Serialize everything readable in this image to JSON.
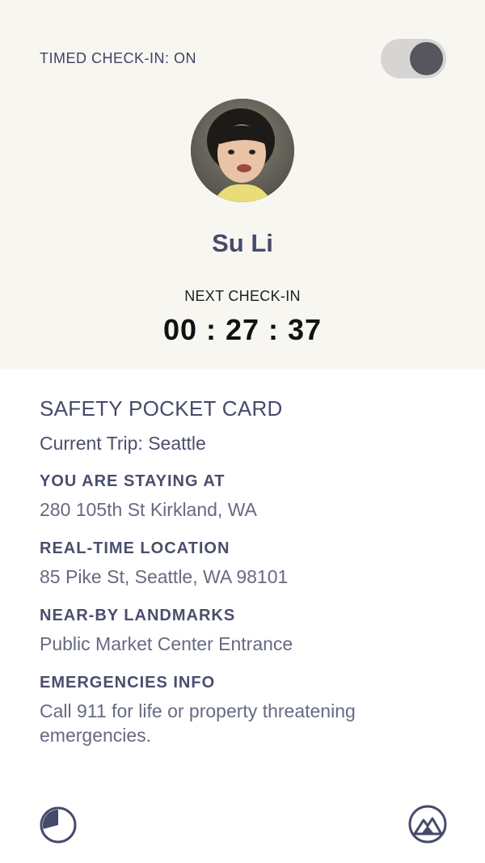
{
  "header": {
    "checkin_status": "TIMED CHECK-IN: ON",
    "toggle_on": true
  },
  "profile": {
    "name": "Su Li",
    "avatar_icon": "profile-photo"
  },
  "next_checkin": {
    "label": "NEXT CHECK-IN",
    "countdown": "00 : 27 : 37"
  },
  "card": {
    "title": "SAFETY POCKET CARD",
    "current_trip": "Current Trip: Seattle",
    "sections": [
      {
        "heading": "YOU ARE STAYING AT",
        "value": "280 105th St Kirkland, WA"
      },
      {
        "heading": "REAL-TIME LOCATION",
        "value": "85 Pike St, Seattle, WA 98101"
      },
      {
        "heading": "NEAR-BY LANDMARKS",
        "value": "Public Market Center Entrance"
      },
      {
        "heading": "EMERGENCIES INFO",
        "value": "Call 911 for life or property threatening emergencies."
      }
    ]
  },
  "bottom_nav": {
    "left_icon": "timer-icon",
    "right_icon": "mountain-icon"
  },
  "colors": {
    "top_background": "#f8f6f1",
    "text_primary": "#464a6b",
    "toggle_track": "#d6d5d3",
    "toggle_knob": "#56565c"
  }
}
